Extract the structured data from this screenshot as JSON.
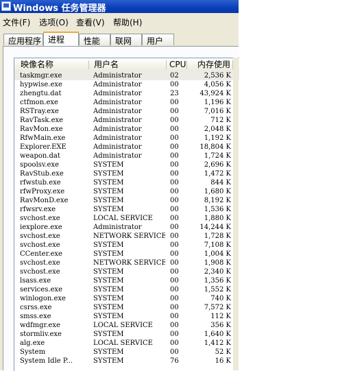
{
  "window": {
    "title": "Windows 任务管理器"
  },
  "menu": [
    "文件(F)",
    "选项(O)",
    "查看(V)",
    "帮助(H)"
  ],
  "tabs": [
    {
      "label": "应用程序",
      "active": false
    },
    {
      "label": "进程",
      "active": true
    },
    {
      "label": "性能",
      "active": false
    },
    {
      "label": "联网",
      "active": false
    },
    {
      "label": "用户",
      "active": false
    }
  ],
  "table": {
    "headers": {
      "name": "映像名称",
      "user": "用户名",
      "cpu": "CPU",
      "mem": "内存使用"
    },
    "rows": [
      {
        "name": "taskmgr.exe",
        "user": "Administrator",
        "cpu": "02",
        "mem": "2,536 K",
        "selected": true
      },
      {
        "name": "hypwise.exe",
        "user": "Administrator",
        "cpu": "00",
        "mem": "4,056 K"
      },
      {
        "name": "zhengtu.dat",
        "user": "Administrator",
        "cpu": "23",
        "mem": "43,924 K"
      },
      {
        "name": "ctfmon.exe",
        "user": "Administrator",
        "cpu": "00",
        "mem": "1,196 K"
      },
      {
        "name": "RSTray.exe",
        "user": "Administrator",
        "cpu": "00",
        "mem": "7,016 K"
      },
      {
        "name": "RavTask.exe",
        "user": "Administrator",
        "cpu": "00",
        "mem": "712 K"
      },
      {
        "name": "RavMon.exe",
        "user": "Administrator",
        "cpu": "00",
        "mem": "2,048 K"
      },
      {
        "name": "RfwMain.exe",
        "user": "Administrator",
        "cpu": "00",
        "mem": "1,192 K"
      },
      {
        "name": "Explorer.EXE",
        "user": "Administrator",
        "cpu": "00",
        "mem": "18,804 K"
      },
      {
        "name": "weapon.dat",
        "user": "Administrator",
        "cpu": "00",
        "mem": "1,724 K"
      },
      {
        "name": "spoolsv.exe",
        "user": "SYSTEM",
        "cpu": "00",
        "mem": "2,696 K"
      },
      {
        "name": "RavStub.exe",
        "user": "SYSTEM",
        "cpu": "00",
        "mem": "1,472 K"
      },
      {
        "name": "rfwstub.exe",
        "user": "SYSTEM",
        "cpu": "00",
        "mem": "844 K"
      },
      {
        "name": "rfwProxy.exe",
        "user": "SYSTEM",
        "cpu": "00",
        "mem": "1,680 K"
      },
      {
        "name": "RavMonD.exe",
        "user": "SYSTEM",
        "cpu": "00",
        "mem": "8,192 K"
      },
      {
        "name": "rfwsrv.exe",
        "user": "SYSTEM",
        "cpu": "00",
        "mem": "1,536 K"
      },
      {
        "name": "svchost.exe",
        "user": "LOCAL SERVICE",
        "cpu": "00",
        "mem": "1,880 K"
      },
      {
        "name": "iexplore.exe",
        "user": "Administrator",
        "cpu": "00",
        "mem": "14,244 K"
      },
      {
        "name": "svchost.exe",
        "user": "NETWORK SERVICE",
        "cpu": "00",
        "mem": "1,728 K"
      },
      {
        "name": "svchost.exe",
        "user": "SYSTEM",
        "cpu": "00",
        "mem": "7,108 K"
      },
      {
        "name": "CCenter.exe",
        "user": "SYSTEM",
        "cpu": "00",
        "mem": "1,004 K"
      },
      {
        "name": "svchost.exe",
        "user": "NETWORK SERVICE",
        "cpu": "00",
        "mem": "1,908 K"
      },
      {
        "name": "svchost.exe",
        "user": "SYSTEM",
        "cpu": "00",
        "mem": "2,340 K"
      },
      {
        "name": "lsass.exe",
        "user": "SYSTEM",
        "cpu": "00",
        "mem": "1,356 K"
      },
      {
        "name": "services.exe",
        "user": "SYSTEM",
        "cpu": "00",
        "mem": "1,552 K"
      },
      {
        "name": "winlogon.exe",
        "user": "SYSTEM",
        "cpu": "00",
        "mem": "740 K"
      },
      {
        "name": "csrss.exe",
        "user": "SYSTEM",
        "cpu": "00",
        "mem": "7,572 K"
      },
      {
        "name": "smss.exe",
        "user": "SYSTEM",
        "cpu": "00",
        "mem": "112 K"
      },
      {
        "name": "wdfmgr.exe",
        "user": "LOCAL SERVICE",
        "cpu": "00",
        "mem": "356 K"
      },
      {
        "name": "stormliv.exe",
        "user": "SYSTEM",
        "cpu": "00",
        "mem": "1,640 K"
      },
      {
        "name": "alg.exe",
        "user": "LOCAL SERVICE",
        "cpu": "00",
        "mem": "1,412 K"
      },
      {
        "name": "System",
        "user": "SYSTEM",
        "cpu": "00",
        "mem": "52 K"
      },
      {
        "name": "System Idle P...",
        "user": "SYSTEM",
        "cpu": "76",
        "mem": "16 K"
      }
    ]
  },
  "colors": {
    "titlebar": "#0a3fb8",
    "tab_highlight": "#f0a838",
    "selected_row": "#ecebe6"
  }
}
